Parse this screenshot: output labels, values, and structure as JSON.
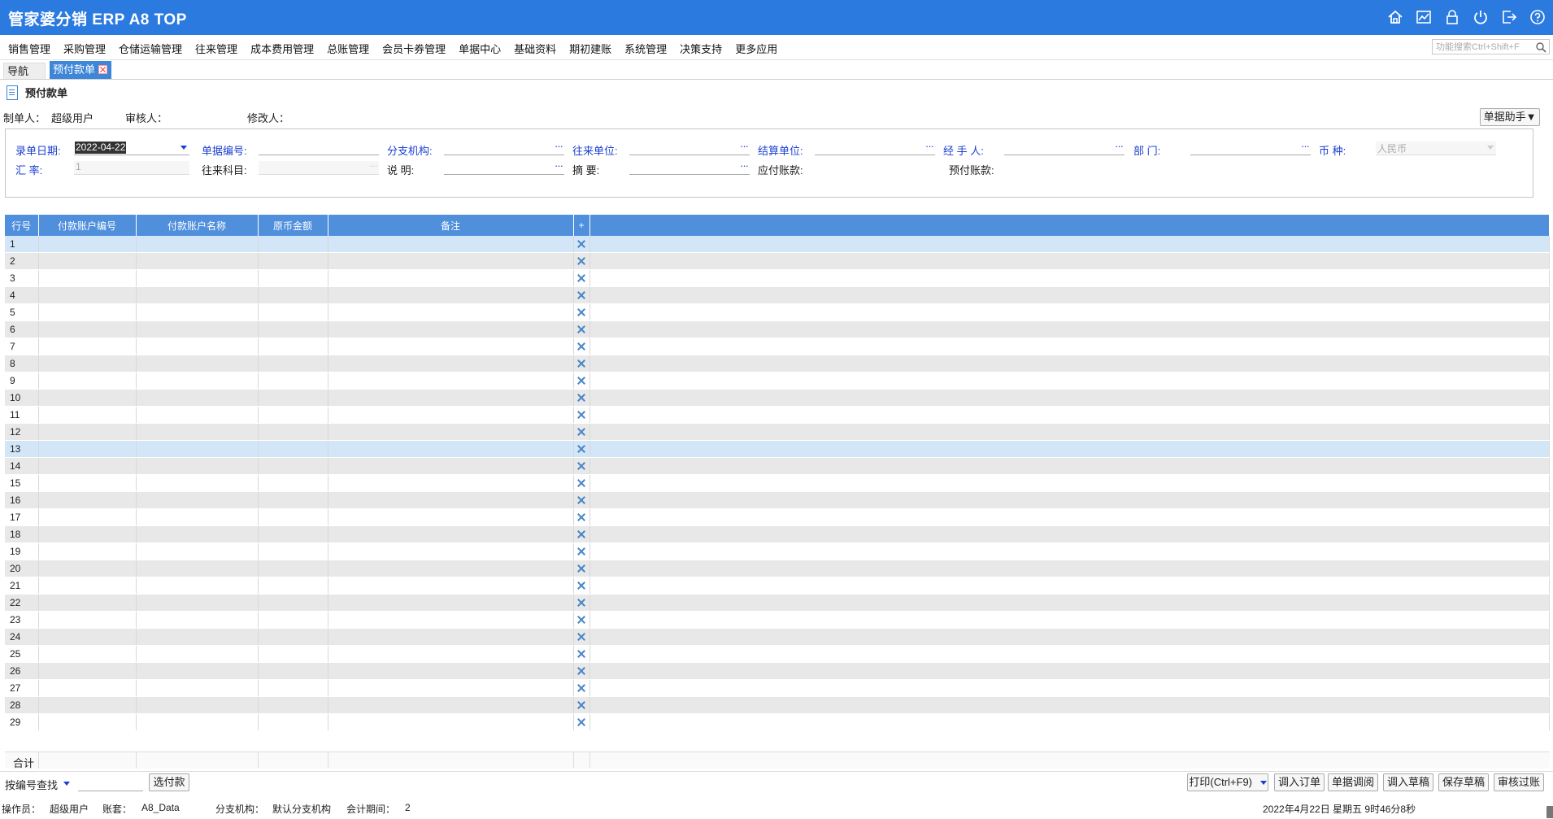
{
  "app": {
    "title": "管家婆分销 ERP A8 TOP"
  },
  "top_icons": [
    "home-icon",
    "chart-icon",
    "lock-icon",
    "power-icon",
    "logout-icon",
    "help-icon"
  ],
  "menu": [
    "销售管理",
    "采购管理",
    "仓储运输管理",
    "往来管理",
    "成本费用管理",
    "总账管理",
    "会员卡券管理",
    "单据中心",
    "基础资料",
    "期初建账",
    "系统管理",
    "决策支持",
    "更多应用"
  ],
  "search": {
    "placeholder": "功能搜索Ctrl+Shift+F"
  },
  "tabs": {
    "nav": "导航",
    "active": "预付款单"
  },
  "doc": {
    "title": "预付款单",
    "maker_label": "制单人：",
    "maker": "超级用户",
    "auditor_label": "审核人：",
    "editor_label": "修改人：",
    "helper_button": "单据助手▼"
  },
  "form": {
    "date_label": "录单日期:",
    "date_value": "2022-04-22",
    "bill_no_label": "单据编号:",
    "branch_label": "分支机构:",
    "partner_label": "往来单位:",
    "settle_label": "结算单位:",
    "handler_label": "经 手 人:",
    "dept_label": "部    门:",
    "currency_label": "币    种:",
    "currency_value": "人民币",
    "rate_label": "汇    率:",
    "rate_value": "1",
    "subject_label": "往来科目:",
    "note_label": "说    明:",
    "summary_label": "摘    要:",
    "payable_label": "应付账款:",
    "prepaid_label": "预付账款:"
  },
  "grid": {
    "columns": [
      "行号",
      "付款账户编号",
      "付款账户名称",
      "原币金额",
      "备注",
      "+"
    ],
    "rows": [
      "1",
      "2",
      "3",
      "4",
      "5",
      "6",
      "7",
      "8",
      "9",
      "10",
      "11",
      "12",
      "13",
      "14",
      "15",
      "16",
      "17",
      "18",
      "19",
      "20",
      "21",
      "22",
      "23",
      "24",
      "25",
      "26",
      "27",
      "28",
      "29"
    ],
    "selected_rows": [
      1,
      13
    ],
    "total_label": "合计"
  },
  "bottom": {
    "find_label": "按编号查找",
    "select_button": "选付款",
    "buttons": [
      "打印(Ctrl+F9)",
      "调入订单",
      "单据调阅",
      "调入草稿",
      "保存草稿",
      "审核过账"
    ]
  },
  "status": {
    "operator_label": "操作员：",
    "operator": "超级用户",
    "account_label": "账套：",
    "account": "A8_Data",
    "branch_label": "分支机构：",
    "branch": "默认分支机构",
    "period_label": "会计期间：",
    "period": "2",
    "datetime": "2022年4月22日  星期五  9时46分8秒"
  },
  "colors": {
    "primary": "#2b7ae0",
    "tab": "#3d86d8",
    "header": "#4f8fdc",
    "label_blue": "#1a3fd0"
  }
}
